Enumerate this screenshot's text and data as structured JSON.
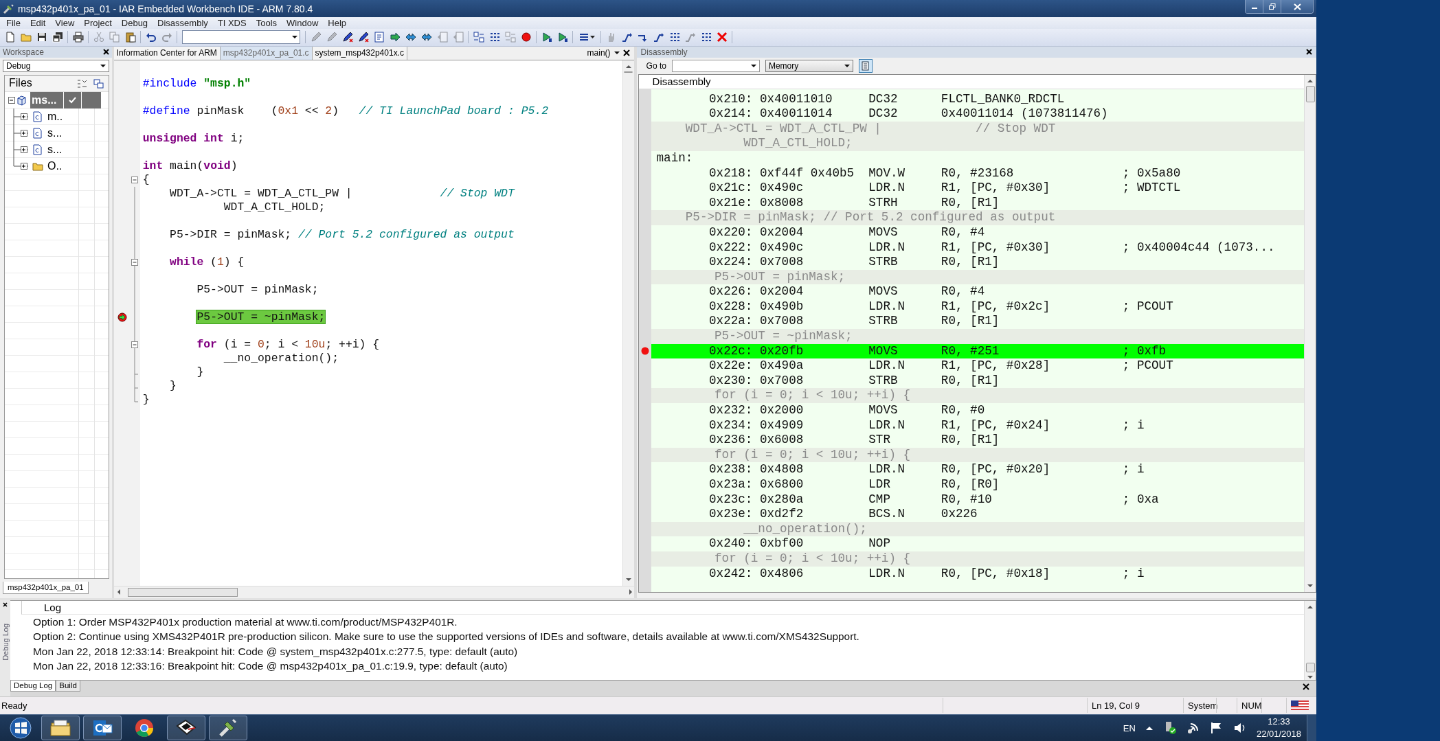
{
  "window": {
    "title": "msp432p401x_pa_01 - IAR Embedded Workbench IDE - ARM 7.80.4"
  },
  "menu": [
    "File",
    "Edit",
    "View",
    "Project",
    "Debug",
    "Disassembly",
    "TI XDS",
    "Tools",
    "Window",
    "Help"
  ],
  "toolbar": {
    "groups": [
      [
        {
          "disabled": false
        },
        {
          "disabled": false
        },
        {
          "disabled": false
        },
        {
          "disabled": false
        }
      ],
      [
        {
          "disabled": false
        }
      ],
      [
        {
          "disabled": true
        },
        {
          "disabled": true
        },
        {
          "disabled": false
        }
      ],
      [
        {
          "disabled": false
        },
        {
          "disabled": true
        }
      ],
      [
        {
          "disabled": true
        },
        {
          "disabled": true
        },
        {
          "disabled": false
        },
        {
          "disabled": false
        },
        {
          "disabled": false
        },
        {
          "disabled": false
        },
        {
          "disabled": false
        },
        {
          "disabled": false
        },
        {
          "disabled": true
        },
        {
          "disabled": true
        }
      ],
      [
        {
          "disabled": false
        },
        {
          "disabled": false
        },
        {
          "disabled": true
        },
        {
          "disabled": false
        }
      ],
      [
        {
          "disabled": false
        },
        {
          "disabled": false
        }
      ],
      [
        {
          "disabled": false
        }
      ],
      [
        {
          "disabled": true
        },
        {
          "disabled": false
        },
        {
          "disabled": false
        },
        {
          "disabled": false
        },
        {
          "disabled": false
        },
        {
          "disabled": true
        },
        {
          "disabled": false
        },
        {
          "disabled": false
        }
      ]
    ]
  },
  "workspace": {
    "title": "Workspace",
    "configuration": "Debug",
    "files_header": "Files",
    "root": {
      "label": "ms...",
      "selected": true,
      "expanded": true,
      "checked": true,
      "children": [
        {
          "label": "m..",
          "kind": "file",
          "expanded": false
        },
        {
          "label": "s...",
          "kind": "file",
          "expanded": false
        },
        {
          "label": "s...",
          "kind": "file",
          "expanded": false
        },
        {
          "label": "O..",
          "kind": "folder",
          "expanded": false
        }
      ]
    },
    "bottom_tab": "msp432p401x_pa_01"
  },
  "editor": {
    "tabs": [
      {
        "label": "Information Center for ARM",
        "selected": false
      },
      {
        "label": "msp432p401x_pa_01.c",
        "selected": true
      },
      {
        "label": "system_msp432p401x.c",
        "selected": false
      }
    ],
    "function": "main()",
    "lines": [
      {
        "kind": "blank"
      },
      {
        "kind": "code",
        "current": false,
        "breakpoint": false,
        "tokens": [
          {
            "kind": "pp",
            "text": "#include "
          },
          {
            "kind": "str",
            "text": "\"msp.h\""
          }
        ]
      },
      {
        "kind": "blank"
      },
      {
        "kind": "code",
        "current": false,
        "breakpoint": false,
        "tokens": [
          {
            "kind": "pp",
            "text": "#define"
          },
          {
            "kind": "plain",
            "text": " pinMask    ("
          },
          {
            "kind": "num",
            "text": "0x1"
          },
          {
            "kind": "plain",
            "text": " << "
          },
          {
            "kind": "num",
            "text": "2"
          },
          {
            "kind": "plain",
            "text": ")   "
          },
          {
            "kind": "comment",
            "text": "// TI LaunchPad board : P5.2"
          }
        ]
      },
      {
        "kind": "blank"
      },
      {
        "kind": "code",
        "current": false,
        "breakpoint": false,
        "tokens": [
          {
            "kind": "keyword",
            "text": "unsigned int"
          },
          {
            "kind": "plain",
            "text": " i;"
          }
        ]
      },
      {
        "kind": "blank"
      },
      {
        "kind": "code",
        "current": false,
        "breakpoint": false,
        "tokens": [
          {
            "kind": "keyword",
            "text": "int"
          },
          {
            "kind": "plain",
            "text": " main("
          },
          {
            "kind": "keyword",
            "text": "void"
          },
          {
            "kind": "plain",
            "text": ")"
          }
        ]
      },
      {
        "kind": "block_start",
        "current": false,
        "breakpoint": false,
        "tokens": [
          {
            "kind": "plain",
            "text": "{"
          }
        ]
      },
      {
        "kind": "code",
        "current": false,
        "breakpoint": false,
        "tokens": [
          {
            "kind": "plain",
            "text": "    WDT_A->CTL = WDT_A_CTL_PW |             "
          },
          {
            "kind": "comment",
            "text": "// Stop WDT"
          }
        ]
      },
      {
        "kind": "code",
        "current": false,
        "breakpoint": false,
        "tokens": [
          {
            "kind": "plain",
            "text": "            WDT_A_CTL_HOLD;"
          }
        ]
      },
      {
        "kind": "blank"
      },
      {
        "kind": "code",
        "current": false,
        "breakpoint": false,
        "tokens": [
          {
            "kind": "plain",
            "text": "    P5->DIR = pinMask; "
          },
          {
            "kind": "comment",
            "text": "// Port 5.2 configured as output"
          }
        ]
      },
      {
        "kind": "blank"
      },
      {
        "kind": "block_start",
        "current": false,
        "breakpoint": false,
        "tokens": [
          {
            "kind": "keyword",
            "text": "    while"
          },
          {
            "kind": "plain",
            "text": " ("
          },
          {
            "kind": "num",
            "text": "1"
          },
          {
            "kind": "plain",
            "text": ") {"
          }
        ]
      },
      {
        "kind": "blank"
      },
      {
        "kind": "code",
        "current": false,
        "breakpoint": false,
        "tokens": [
          {
            "kind": "plain",
            "text": "        P5->OUT = pinMask;"
          }
        ]
      },
      {
        "kind": "blank"
      },
      {
        "kind": "code",
        "current": true,
        "breakpoint": true,
        "tokens": [
          {
            "kind": "plain",
            "text": "        P5->OUT = ~pinMask;"
          }
        ]
      },
      {
        "kind": "blank"
      },
      {
        "kind": "block_start",
        "current": false,
        "breakpoint": false,
        "tokens": [
          {
            "kind": "keyword",
            "text": "        for"
          },
          {
            "kind": "plain",
            "text": " (i = "
          },
          {
            "kind": "num",
            "text": "0"
          },
          {
            "kind": "plain",
            "text": "; i < "
          },
          {
            "kind": "num",
            "text": "10u"
          },
          {
            "kind": "plain",
            "text": "; ++i) {"
          }
        ]
      },
      {
        "kind": "code",
        "current": false,
        "breakpoint": false,
        "tokens": [
          {
            "kind": "plain",
            "text": "            __no_operation();"
          }
        ]
      },
      {
        "kind": "block_end",
        "current": false,
        "breakpoint": false,
        "tokens": [
          {
            "kind": "plain",
            "text": "        }"
          }
        ]
      },
      {
        "kind": "block_end",
        "current": false,
        "breakpoint": false,
        "tokens": [
          {
            "kind": "plain",
            "text": "    }"
          }
        ]
      },
      {
        "kind": "block_end",
        "current": false,
        "breakpoint": false,
        "tokens": [
          {
            "kind": "plain",
            "text": "}"
          }
        ]
      }
    ]
  },
  "disassembly": {
    "title": "Disassembly",
    "goto_label": "Go to",
    "memory": "Memory",
    "header": "Disassembly",
    "rows": [
      {
        "kind": "instr",
        "addr": "0x210:",
        "code": "0x40011010",
        "mnemonic": "DC32",
        "operands": "FLCTL_BANK0_RDCTL",
        "current": false,
        "breakpoint": false
      },
      {
        "kind": "instr",
        "addr": "0x214:",
        "code": "0x40011014",
        "mnemonic": "DC32",
        "operands": "0x40011014 (1073811476)",
        "current": false,
        "breakpoint": false
      },
      {
        "kind": "source",
        "text": "    WDT_A->CTL = WDT_A_CTL_PW |             // Stop WDT"
      },
      {
        "kind": "source",
        "text": "            WDT_A_CTL_HOLD;"
      },
      {
        "kind": "label",
        "text": "main:"
      },
      {
        "kind": "instr",
        "addr": "0x218:",
        "code": "0xf44f 0x40b5",
        "mnemonic": "MOV.W",
        "operands": "R0, #23168",
        "comment": "; 0x5a80",
        "current": false,
        "breakpoint": false
      },
      {
        "kind": "instr",
        "addr": "0x21c:",
        "code": "0x490c",
        "mnemonic": "LDR.N",
        "operands": "R1, [PC, #0x30]",
        "comment": "; WDTCTL",
        "current": false,
        "breakpoint": false
      },
      {
        "kind": "instr",
        "addr": "0x21e:",
        "code": "0x8008",
        "mnemonic": "STRH",
        "operands": "R0, [R1]",
        "current": false,
        "breakpoint": false
      },
      {
        "kind": "source",
        "text": "    P5->DIR = pinMask; // Port 5.2 configured as output"
      },
      {
        "kind": "instr",
        "addr": "0x220:",
        "code": "0x2004",
        "mnemonic": "MOVS",
        "operands": "R0, #4",
        "current": false,
        "breakpoint": false
      },
      {
        "kind": "instr",
        "addr": "0x222:",
        "code": "0x490c",
        "mnemonic": "LDR.N",
        "operands": "R1, [PC, #0x30]",
        "comment": "; 0x40004c44 (1073...",
        "current": false,
        "breakpoint": false
      },
      {
        "kind": "instr",
        "addr": "0x224:",
        "code": "0x7008",
        "mnemonic": "STRB",
        "operands": "R0, [R1]",
        "current": false,
        "breakpoint": false
      },
      {
        "kind": "source",
        "text": "        P5->OUT = pinMask;"
      },
      {
        "kind": "instr",
        "addr": "0x226:",
        "code": "0x2004",
        "mnemonic": "MOVS",
        "operands": "R0, #4",
        "current": false,
        "breakpoint": false
      },
      {
        "kind": "instr",
        "addr": "0x228:",
        "code": "0x490b",
        "mnemonic": "LDR.N",
        "operands": "R1, [PC, #0x2c]",
        "comment": "; PCOUT",
        "current": false,
        "breakpoint": false
      },
      {
        "kind": "instr",
        "addr": "0x22a:",
        "code": "0x7008",
        "mnemonic": "STRB",
        "operands": "R0, [R1]",
        "current": false,
        "breakpoint": false
      },
      {
        "kind": "source",
        "text": "        P5->OUT = ~pinMask;"
      },
      {
        "kind": "instr",
        "addr": "0x22c:",
        "code": "0x20fb",
        "mnemonic": "MOVS",
        "operands": "R0, #251",
        "comment": "; 0xfb",
        "current": true,
        "breakpoint": true
      },
      {
        "kind": "instr",
        "addr": "0x22e:",
        "code": "0x490a",
        "mnemonic": "LDR.N",
        "operands": "R1, [PC, #0x28]",
        "comment": "; PCOUT",
        "current": false,
        "breakpoint": false
      },
      {
        "kind": "instr",
        "addr": "0x230:",
        "code": "0x7008",
        "mnemonic": "STRB",
        "operands": "R0, [R1]",
        "current": false,
        "breakpoint": false
      },
      {
        "kind": "source",
        "text": "        for (i = 0; i < 10u; ++i) {"
      },
      {
        "kind": "instr",
        "addr": "0x232:",
        "code": "0x2000",
        "mnemonic": "MOVS",
        "operands": "R0, #0",
        "current": false,
        "breakpoint": false
      },
      {
        "kind": "instr",
        "addr": "0x234:",
        "code": "0x4909",
        "mnemonic": "LDR.N",
        "operands": "R1, [PC, #0x24]",
        "comment": "; i",
        "current": false,
        "breakpoint": false
      },
      {
        "kind": "instr",
        "addr": "0x236:",
        "code": "0x6008",
        "mnemonic": "STR",
        "operands": "R0, [R1]",
        "current": false,
        "breakpoint": false
      },
      {
        "kind": "source",
        "text": "        for (i = 0; i < 10u; ++i) {"
      },
      {
        "kind": "instr",
        "addr": "0x238:",
        "code": "0x4808",
        "mnemonic": "LDR.N",
        "operands": "R0, [PC, #0x20]",
        "comment": "; i",
        "current": false,
        "breakpoint": false
      },
      {
        "kind": "instr",
        "addr": "0x23a:",
        "code": "0x6800",
        "mnemonic": "LDR",
        "operands": "R0, [R0]",
        "current": false,
        "breakpoint": false
      },
      {
        "kind": "instr",
        "addr": "0x23c:",
        "code": "0x280a",
        "mnemonic": "CMP",
        "operands": "R0, #10",
        "comment": "; 0xa",
        "current": false,
        "breakpoint": false
      },
      {
        "kind": "instr",
        "addr": "0x23e:",
        "code": "0xd2f2",
        "mnemonic": "BCS.N",
        "operands": "0x226",
        "current": false,
        "breakpoint": false
      },
      {
        "kind": "source",
        "text": "            __no_operation();"
      },
      {
        "kind": "instr",
        "addr": "0x240:",
        "code": "0xbf00",
        "mnemonic": "NOP",
        "current": false,
        "breakpoint": false
      },
      {
        "kind": "source",
        "text": "        for (i = 0; i < 10u; ++i) {"
      },
      {
        "kind": "instr",
        "addr": "0x242:",
        "code": "0x4806",
        "mnemonic": "LDR.N",
        "operands": "R0, [PC, #0x18]",
        "comment": "; i",
        "current": false,
        "breakpoint": false
      }
    ]
  },
  "log": {
    "side_label": "Debug Log",
    "header": "Log",
    "lines": [
      "Option 1: Order MSP432P401x production material at www.ti.com/product/MSP432P401R.",
      "Option 2: Continue using XMS432P401R pre-production silicon. Make sure to use the supported versions of IDEs and software, details available at www.ti.com/XMS432Support.",
      "Mon Jan 22, 2018 12:33:14: Breakpoint hit: Code @ system_msp432p401x.c:277.5, type: default (auto)",
      "Mon Jan 22, 2018 12:33:16: Breakpoint hit: Code @ msp432p401x_pa_01.c:19.9, type: default (auto)"
    ],
    "tabs": [
      {
        "label": "Debug Log",
        "selected": true
      },
      {
        "label": "Build",
        "selected": false
      }
    ]
  },
  "status_bar": {
    "message": "Ready",
    "position": "Ln 19, Col 9",
    "mode": "System",
    "num_lock": "NUM"
  },
  "taskbar": {
    "apps": [
      {
        "kind": "explorer",
        "running": true
      },
      {
        "kind": "mail",
        "running": true
      },
      {
        "kind": "browser",
        "running": false
      },
      {
        "kind": "launcher",
        "running": true
      },
      {
        "kind": "ide",
        "running": true
      }
    ],
    "language": "EN",
    "time": "12:33",
    "date": "22/01/2018"
  }
}
